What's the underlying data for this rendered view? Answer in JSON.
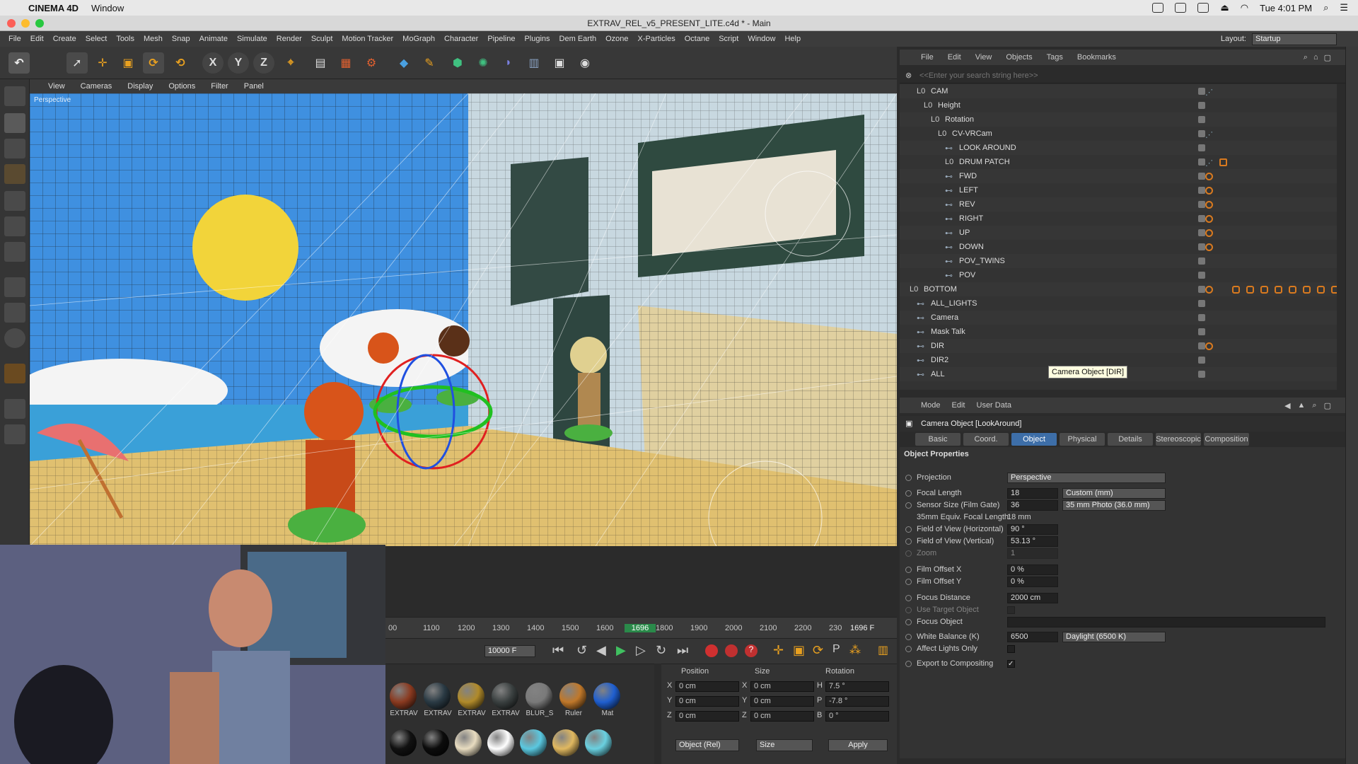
{
  "menubar_mac": {
    "app": "CINEMA 4D",
    "window": "Window",
    "clock": "Tue 4:01 PM"
  },
  "title": "EXTRAV_REL_v5_PRESENT_LITE.c4d * - Main",
  "menu": [
    "File",
    "Edit",
    "Create",
    "Select",
    "Tools",
    "Mesh",
    "Snap",
    "Animate",
    "Simulate",
    "Render",
    "Sculpt",
    "Motion Tracker",
    "MoGraph",
    "Character",
    "Pipeline",
    "Plugins",
    "Dem Earth",
    "Ozone",
    "X-Particles",
    "Octane",
    "Script",
    "Window",
    "Help"
  ],
  "layout": {
    "label": "Layout:",
    "value": "Startup"
  },
  "toolbar": {
    "x": "X",
    "y": "Y",
    "z": "Z"
  },
  "viewport": {
    "menu": [
      "View",
      "Cameras",
      "Display",
      "Options",
      "Filter",
      "Panel"
    ],
    "label": "Perspective"
  },
  "timeline": {
    "ticks": [
      "00",
      "1100",
      "1200",
      "1300",
      "1400",
      "1500",
      "1600",
      "1696",
      "1800",
      "1900",
      "2000",
      "2100",
      "2200",
      "230"
    ],
    "current_frame": "1696 F"
  },
  "transport": {
    "end_frame": "10000 F"
  },
  "materials": [
    {
      "name": "EXTRAV",
      "color": "#8a3a20"
    },
    {
      "name": "EXTRAV",
      "color": "#2a3a44"
    },
    {
      "name": "EXTRAV",
      "color": "#b08a2a"
    },
    {
      "name": "EXTRAV",
      "color": "#3a4040"
    },
    {
      "name": "BLUR_S",
      "color": "#7a7a7a"
    },
    {
      "name": "Ruler",
      "color": "#c0782a"
    },
    {
      "name": "Mat",
      "color": "#1f5fd0"
    }
  ],
  "materials_row2": [
    "#111",
    "#0c0c0c",
    "#e8dcc0",
    "#ffffff",
    "#5ac8e0",
    "#e0b860",
    "#6ad0e0"
  ],
  "coords": {
    "headers": [
      "Position",
      "Size",
      "Rotation"
    ],
    "rows": [
      {
        "axis": "X",
        "pos": "0 cm",
        "size_axis": "X",
        "size": "0 cm",
        "rot_axis": "H",
        "rot": "7.5 °"
      },
      {
        "axis": "Y",
        "pos": "0 cm",
        "size_axis": "Y",
        "size": "0 cm",
        "rot_axis": "P",
        "rot": "-7.8 °"
      },
      {
        "axis": "Z",
        "pos": "0 cm",
        "size_axis": "Z",
        "size": "0 cm",
        "rot_axis": "B",
        "rot": "0 °"
      }
    ],
    "mode": "Object (Rel)",
    "size_mode": "Size",
    "apply": "Apply"
  },
  "object_manager": {
    "menu": [
      "File",
      "Edit",
      "View",
      "Objects",
      "Tags",
      "Bookmarks"
    ],
    "search_placeholder": "<<Enter your search string here>>",
    "rows": [
      {
        "name": "CAM",
        "indent": 1,
        "kind": "null",
        "tags": [
          "camtag"
        ]
      },
      {
        "name": "Height",
        "indent": 2,
        "kind": "null",
        "tags": []
      },
      {
        "name": "Rotation",
        "indent": 3,
        "kind": "null",
        "tags": []
      },
      {
        "name": "CV-VRCam",
        "indent": 4,
        "kind": "null",
        "tags": [
          "dots"
        ]
      },
      {
        "name": "LOOK AROUND",
        "indent": 5,
        "kind": "cam",
        "tags": []
      },
      {
        "name": "DRUM PATCH",
        "indent": 5,
        "kind": "null",
        "tags": [
          "dots",
          "xo"
        ]
      },
      {
        "name": "FWD",
        "indent": 5,
        "kind": "cam",
        "tags": [
          "o"
        ]
      },
      {
        "name": "LEFT",
        "indent": 5,
        "kind": "cam",
        "tags": [
          "o"
        ]
      },
      {
        "name": "REV",
        "indent": 5,
        "kind": "cam",
        "tags": [
          "o"
        ]
      },
      {
        "name": "RIGHT",
        "indent": 5,
        "kind": "cam",
        "tags": [
          "o"
        ]
      },
      {
        "name": "UP",
        "indent": 5,
        "kind": "cam",
        "tags": [
          "o"
        ]
      },
      {
        "name": "DOWN",
        "indent": 5,
        "kind": "cam",
        "tags": [
          "o"
        ]
      },
      {
        "name": "POV_TWINS",
        "indent": 5,
        "kind": "cam",
        "tags": []
      },
      {
        "name": "POV",
        "indent": 5,
        "kind": "cam",
        "tags": []
      },
      {
        "name": "BOTTOM",
        "indent": 0,
        "kind": "null",
        "tags": [
          "o",
          "row"
        ]
      },
      {
        "name": "ALL_LIGHTS",
        "indent": 1,
        "kind": "cam",
        "tags": []
      },
      {
        "name": "Camera",
        "indent": 1,
        "kind": "cam",
        "tags": []
      },
      {
        "name": "Mask Talk",
        "indent": 1,
        "kind": "cam",
        "tags": []
      },
      {
        "name": "DIR",
        "indent": 1,
        "kind": "cam",
        "tags": [
          "o"
        ]
      },
      {
        "name": "DIR2",
        "indent": 1,
        "kind": "cam",
        "tags": []
      },
      {
        "name": "ALL",
        "indent": 1,
        "kind": "cam",
        "tags": []
      }
    ],
    "tooltip": "Camera Object [DIR]"
  },
  "attributes": {
    "menu": [
      "Mode",
      "Edit",
      "User Data"
    ],
    "title": "Camera Object [LookAround]",
    "tabs": [
      "Basic",
      "Coord.",
      "Object",
      "Physical",
      "Details",
      "Stereoscopic",
      "Composition"
    ],
    "active_tab": "Object",
    "section": "Object Properties",
    "props": [
      {
        "label": "Projection",
        "value": "",
        "dd": "Perspective",
        "wide": true
      },
      {
        "label": "Focal Length",
        "value": "18",
        "dd": "Custom (mm)"
      },
      {
        "label": "Sensor Size (Film Gate)",
        "value": "36",
        "dd": "35 mm Photo (36.0 mm)"
      },
      {
        "label": "35mm Equiv. Focal Length:",
        "value": "18 mm",
        "plain": true
      },
      {
        "label": "Field of View (Horizontal)",
        "value": "90 °"
      },
      {
        "label": "Field of View (Vertical)",
        "value": "53.13 °"
      },
      {
        "label": "Zoom",
        "value": "1",
        "dim": true
      },
      {
        "label": "Film Offset X",
        "value": "0 %"
      },
      {
        "label": "Film Offset Y",
        "value": "0 %"
      },
      {
        "label": "Focus Distance",
        "value": "2000 cm"
      },
      {
        "label": "Use Target Object",
        "value": "",
        "check": true,
        "dim": true
      },
      {
        "label": "Focus Object",
        "value": "",
        "bar": true
      },
      {
        "label": "White Balance (K)",
        "value": "6500",
        "dd": "Daylight (6500 K)"
      },
      {
        "label": "Affect Lights Only",
        "value": "",
        "check": true
      },
      {
        "label": "Export to Compositing",
        "value": "✓",
        "check": true
      }
    ]
  }
}
